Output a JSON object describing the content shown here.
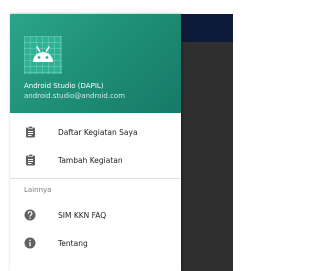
{
  "header": {
    "account_name": "Android Studio (DAPIL)",
    "account_email": "android.studio@android.com"
  },
  "menu": {
    "primary_items": [
      {
        "label": "Daftar Kegiatan Saya",
        "icon": "clipboard-icon"
      },
      {
        "label": "Tambah Kegiatan",
        "icon": "clipboard-icon"
      }
    ],
    "section_title": "Lainnya",
    "secondary_items": [
      {
        "label": "SIM KKN FAQ",
        "icon": "help-circle-icon"
      },
      {
        "label": "Tentang",
        "icon": "info-circle-icon"
      }
    ]
  },
  "colors": {
    "header_accent": "#1e8c75",
    "app_toolbar": "#0e1a3a",
    "app_background": "#2f2f2f",
    "icon": "#616161"
  }
}
